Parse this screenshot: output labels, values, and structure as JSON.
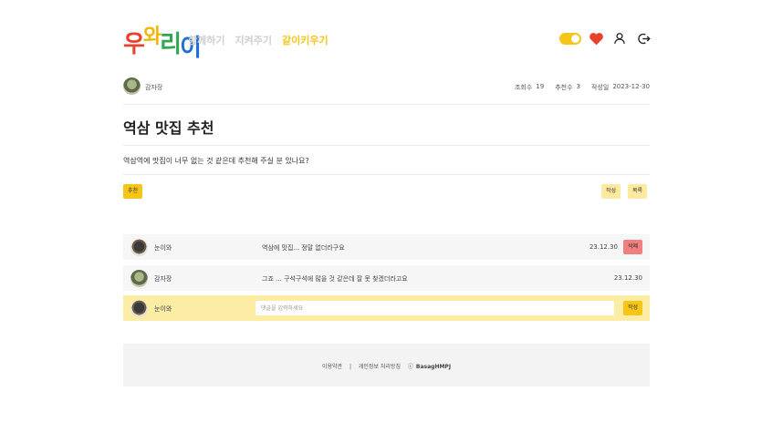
{
  "logo": {
    "chars": [
      "우",
      "와",
      "리",
      "이"
    ]
  },
  "nav": [
    {
      "label": "함께하기",
      "active": false
    },
    {
      "label": "지켜주기",
      "active": false
    },
    {
      "label": "같이키우기",
      "active": true
    }
  ],
  "header_icons": [
    "toggle",
    "heart-icon",
    "user-icon",
    "logout-icon"
  ],
  "colors": {
    "accent": "#f5c518",
    "heart": "#e8412c",
    "delete": "#f08080",
    "input_row": "#fdeca4"
  },
  "post": {
    "author": "감자장",
    "views_label": "조회수",
    "views": "19",
    "likes_label": "추천수",
    "likes": "3",
    "date_label": "작성일",
    "date": "2023-12-30",
    "title": "역삼 맛집 추천",
    "content": "역삼역에 맛집이 너무 없는 것 같은데 추천해 주실 분 있나요?",
    "tag": "추천",
    "write_button": "작성",
    "list_button": "목록"
  },
  "comments": [
    {
      "author": "눈이와",
      "text": "역삼에 맛집... 정말 없더라구요",
      "date": "23.12.30",
      "delete_label": "삭제"
    },
    {
      "author": "감자장",
      "text": "그죠 ... 구석구석에 많을 것 같은데 잘 못 찾겠더라고요",
      "date": "23.12.30"
    }
  ],
  "comment_form": {
    "author": "눈이와",
    "placeholder": "댓글을 입력하세요",
    "submit_label": "작성"
  },
  "footer": {
    "terms": "이용약관",
    "separator": "|",
    "privacy": "개인정보 처리방침",
    "copyright_symbol": "ⓒ",
    "brand": "BasagHMPJ"
  }
}
